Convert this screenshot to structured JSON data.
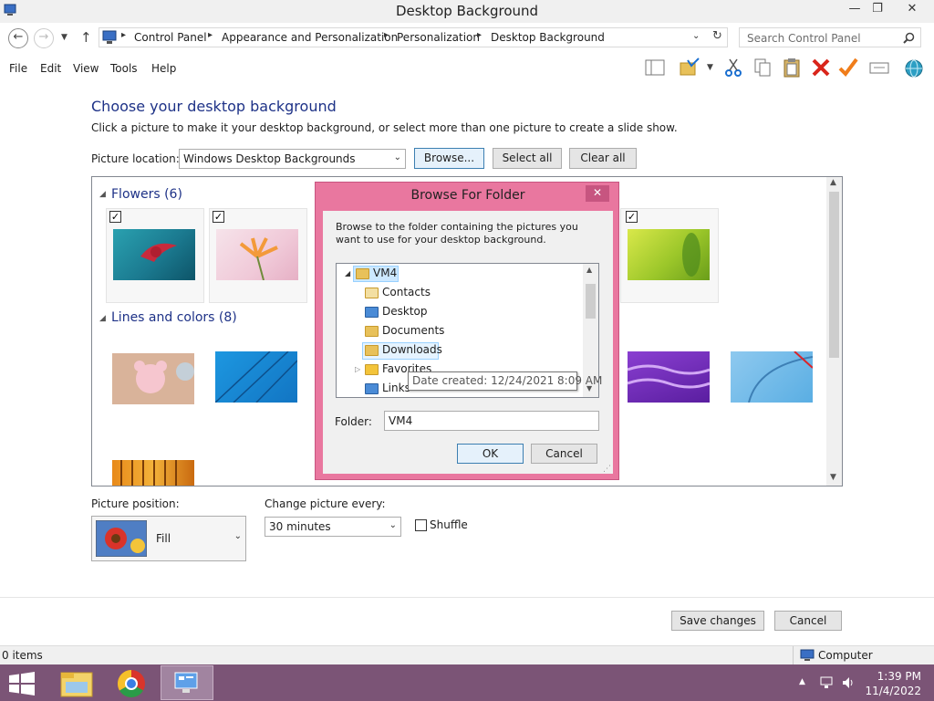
{
  "window": {
    "title": "Desktop Background",
    "minimize_label": "—",
    "restore_label": "❐",
    "close_label": "✕"
  },
  "address": {
    "crumbs": [
      "Control Panel",
      "Appearance and Personalization",
      "Personalization",
      "Desktop Background"
    ],
    "search_placeholder": "Search Control Panel"
  },
  "menu": {
    "items": [
      "File",
      "Edit",
      "View",
      "Tools",
      "Help"
    ]
  },
  "page": {
    "title": "Choose your desktop background",
    "subtitle": "Click a picture to make it your desktop background, or select more than one picture to create a slide show.",
    "picture_location_label": "Picture location:",
    "picture_location_value": "Windows Desktop Backgrounds",
    "browse_label": "Browse...",
    "select_all_label": "Select all",
    "clear_all_label": "Clear all"
  },
  "gallery": {
    "groups": [
      {
        "title": "Flowers (6)"
      },
      {
        "title": "Lines and colors (8)"
      }
    ],
    "checkmark": "✓"
  },
  "options": {
    "position_label": "Picture position:",
    "position_value": "Fill",
    "interval_label": "Change picture every:",
    "interval_value": "30 minutes",
    "shuffle_label": "Shuffle"
  },
  "actions": {
    "save_label": "Save changes",
    "cancel_label": "Cancel"
  },
  "dialog": {
    "title": "Browse For Folder",
    "close_label": "✕",
    "instructions": "Browse to the folder containing the pictures you want to use for your desktop background.",
    "tree": [
      "VM4",
      "Contacts",
      "Desktop",
      "Documents",
      "Downloads",
      "Favorites",
      "Links"
    ],
    "tooltip": "Date created: 12/24/2021 8:09 AM",
    "folder_label": "Folder:",
    "folder_value": "VM4",
    "ok_label": "OK",
    "cancel_label": "Cancel"
  },
  "status": {
    "items_text": "0 items",
    "location_text": "Computer"
  },
  "taskbar": {
    "time": "1:39 PM",
    "date": "11/4/2022"
  },
  "colors": {
    "heading_blue": "#1e3287",
    "dialog_frame": "#e9779f",
    "taskbar": "#7b5476"
  }
}
